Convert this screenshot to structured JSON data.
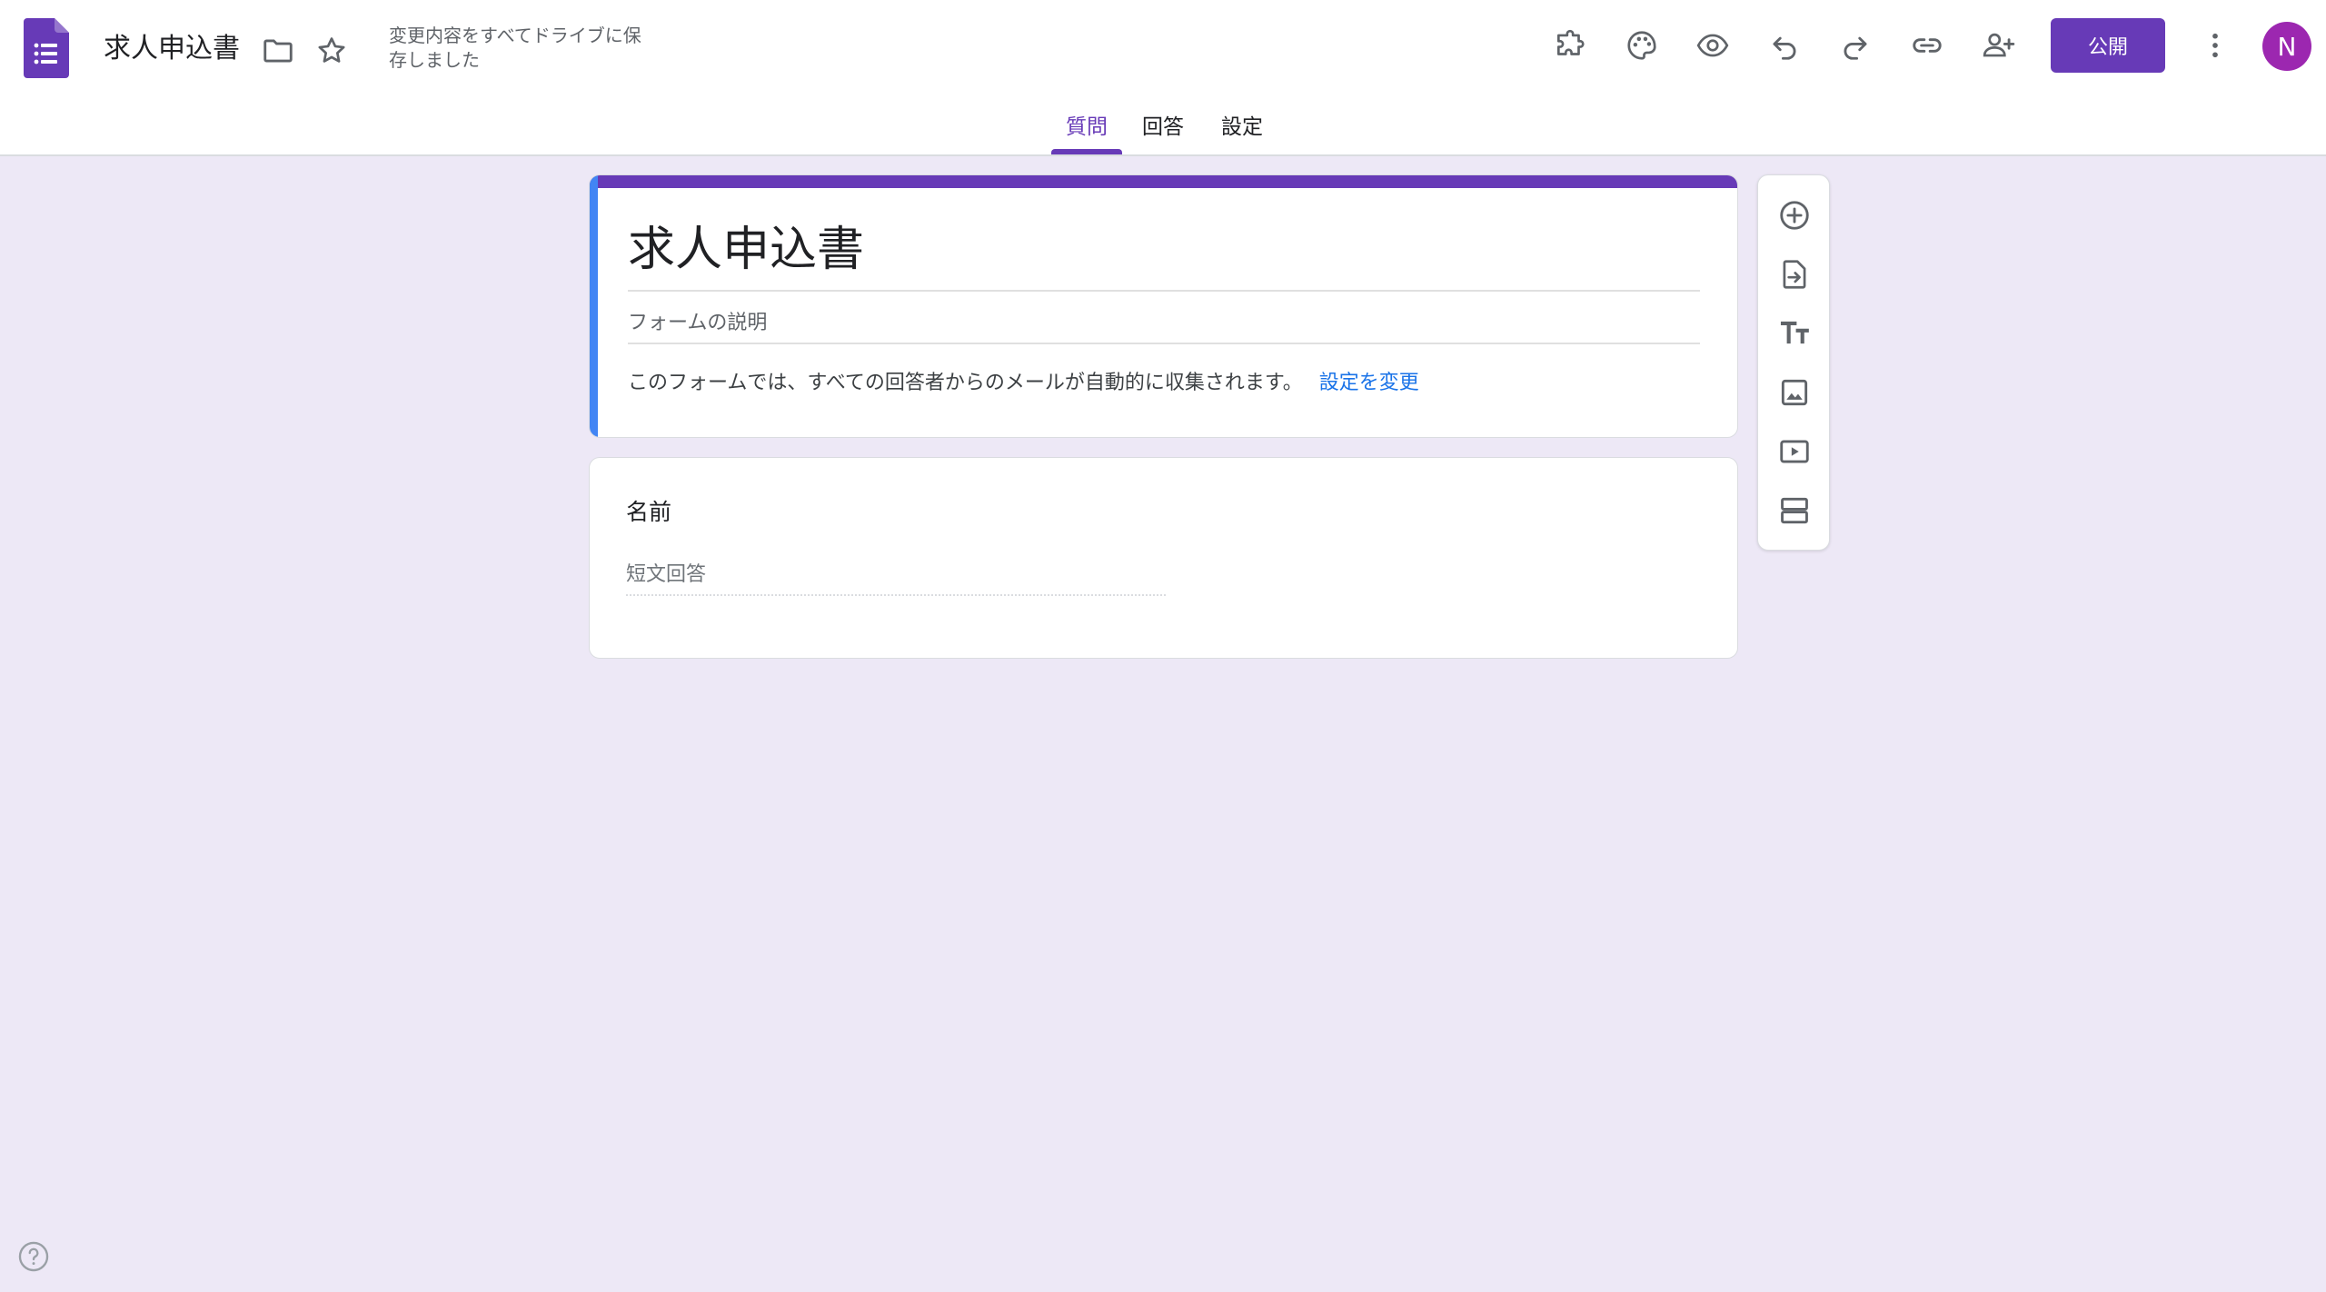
{
  "header": {
    "doc_title": "求人申込書",
    "save_status": "変更内容をすべてドライブに保存しました",
    "publish_label": "公開",
    "avatar_initial": "N",
    "icons": [
      "forms-logo-icon",
      "folder-icon",
      "star-icon",
      "addon-icon",
      "palette-icon",
      "preview-eye-icon",
      "undo-icon",
      "redo-icon",
      "link-icon",
      "add-collaborator-icon",
      "more-vert-icon"
    ]
  },
  "tabs": [
    {
      "label": "質問",
      "active": true
    },
    {
      "label": "回答",
      "active": false
    },
    {
      "label": "設定",
      "active": false
    }
  ],
  "form": {
    "title": "求人申込書",
    "description_placeholder": "フォームの説明",
    "email_notice": "このフォームでは、すべての回答者からのメールが自動的に収集されます。",
    "change_settings_link": "設定を変更"
  },
  "questions": [
    {
      "title": "名前",
      "answer_placeholder": "短文回答"
    }
  ],
  "toolbar": {
    "icons": [
      "add-question-icon",
      "import-questions-icon",
      "add-title-icon",
      "add-image-icon",
      "add-video-icon",
      "add-section-icon"
    ]
  },
  "colors": {
    "accent": "#673ab7",
    "background": "#ede8f6",
    "link": "#1a73e8",
    "title_side_bar": "#4285f4",
    "avatar": "#9c27b0"
  }
}
